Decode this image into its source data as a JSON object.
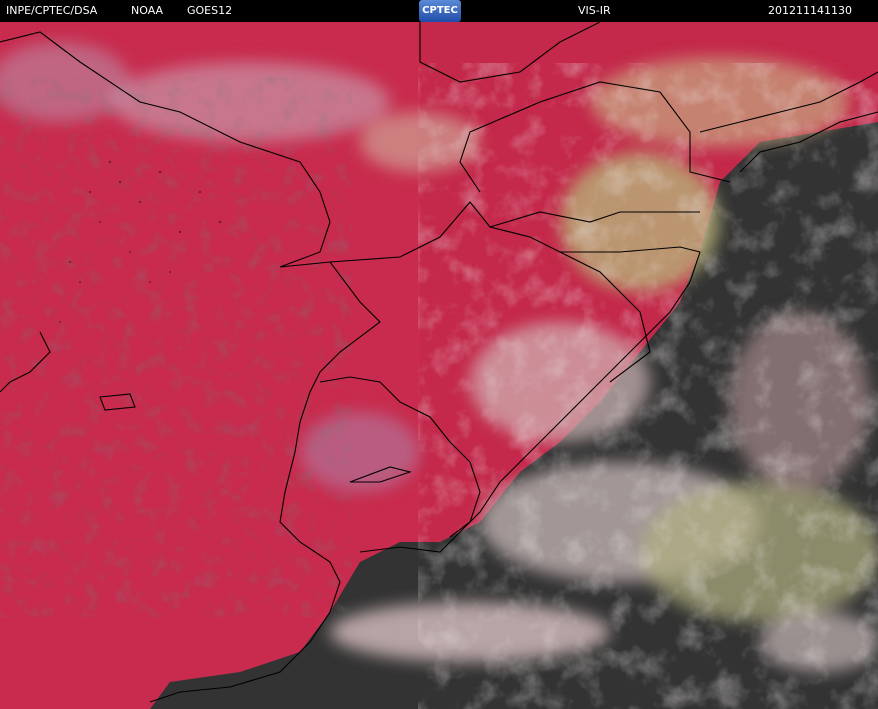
{
  "header": {
    "source": "INPE/CPTEC/DSA",
    "agency": "NOAA",
    "satellite": "GOES12",
    "logo": "CPTEC",
    "channel": "VIS-IR",
    "timestamp": "201211141130"
  },
  "colors": {
    "land_red": "#c8284a",
    "cloud_white": "#d8c8c8",
    "cloud_green": "#a8b070",
    "ocean_dark": "#333333",
    "borders": "#000000"
  }
}
